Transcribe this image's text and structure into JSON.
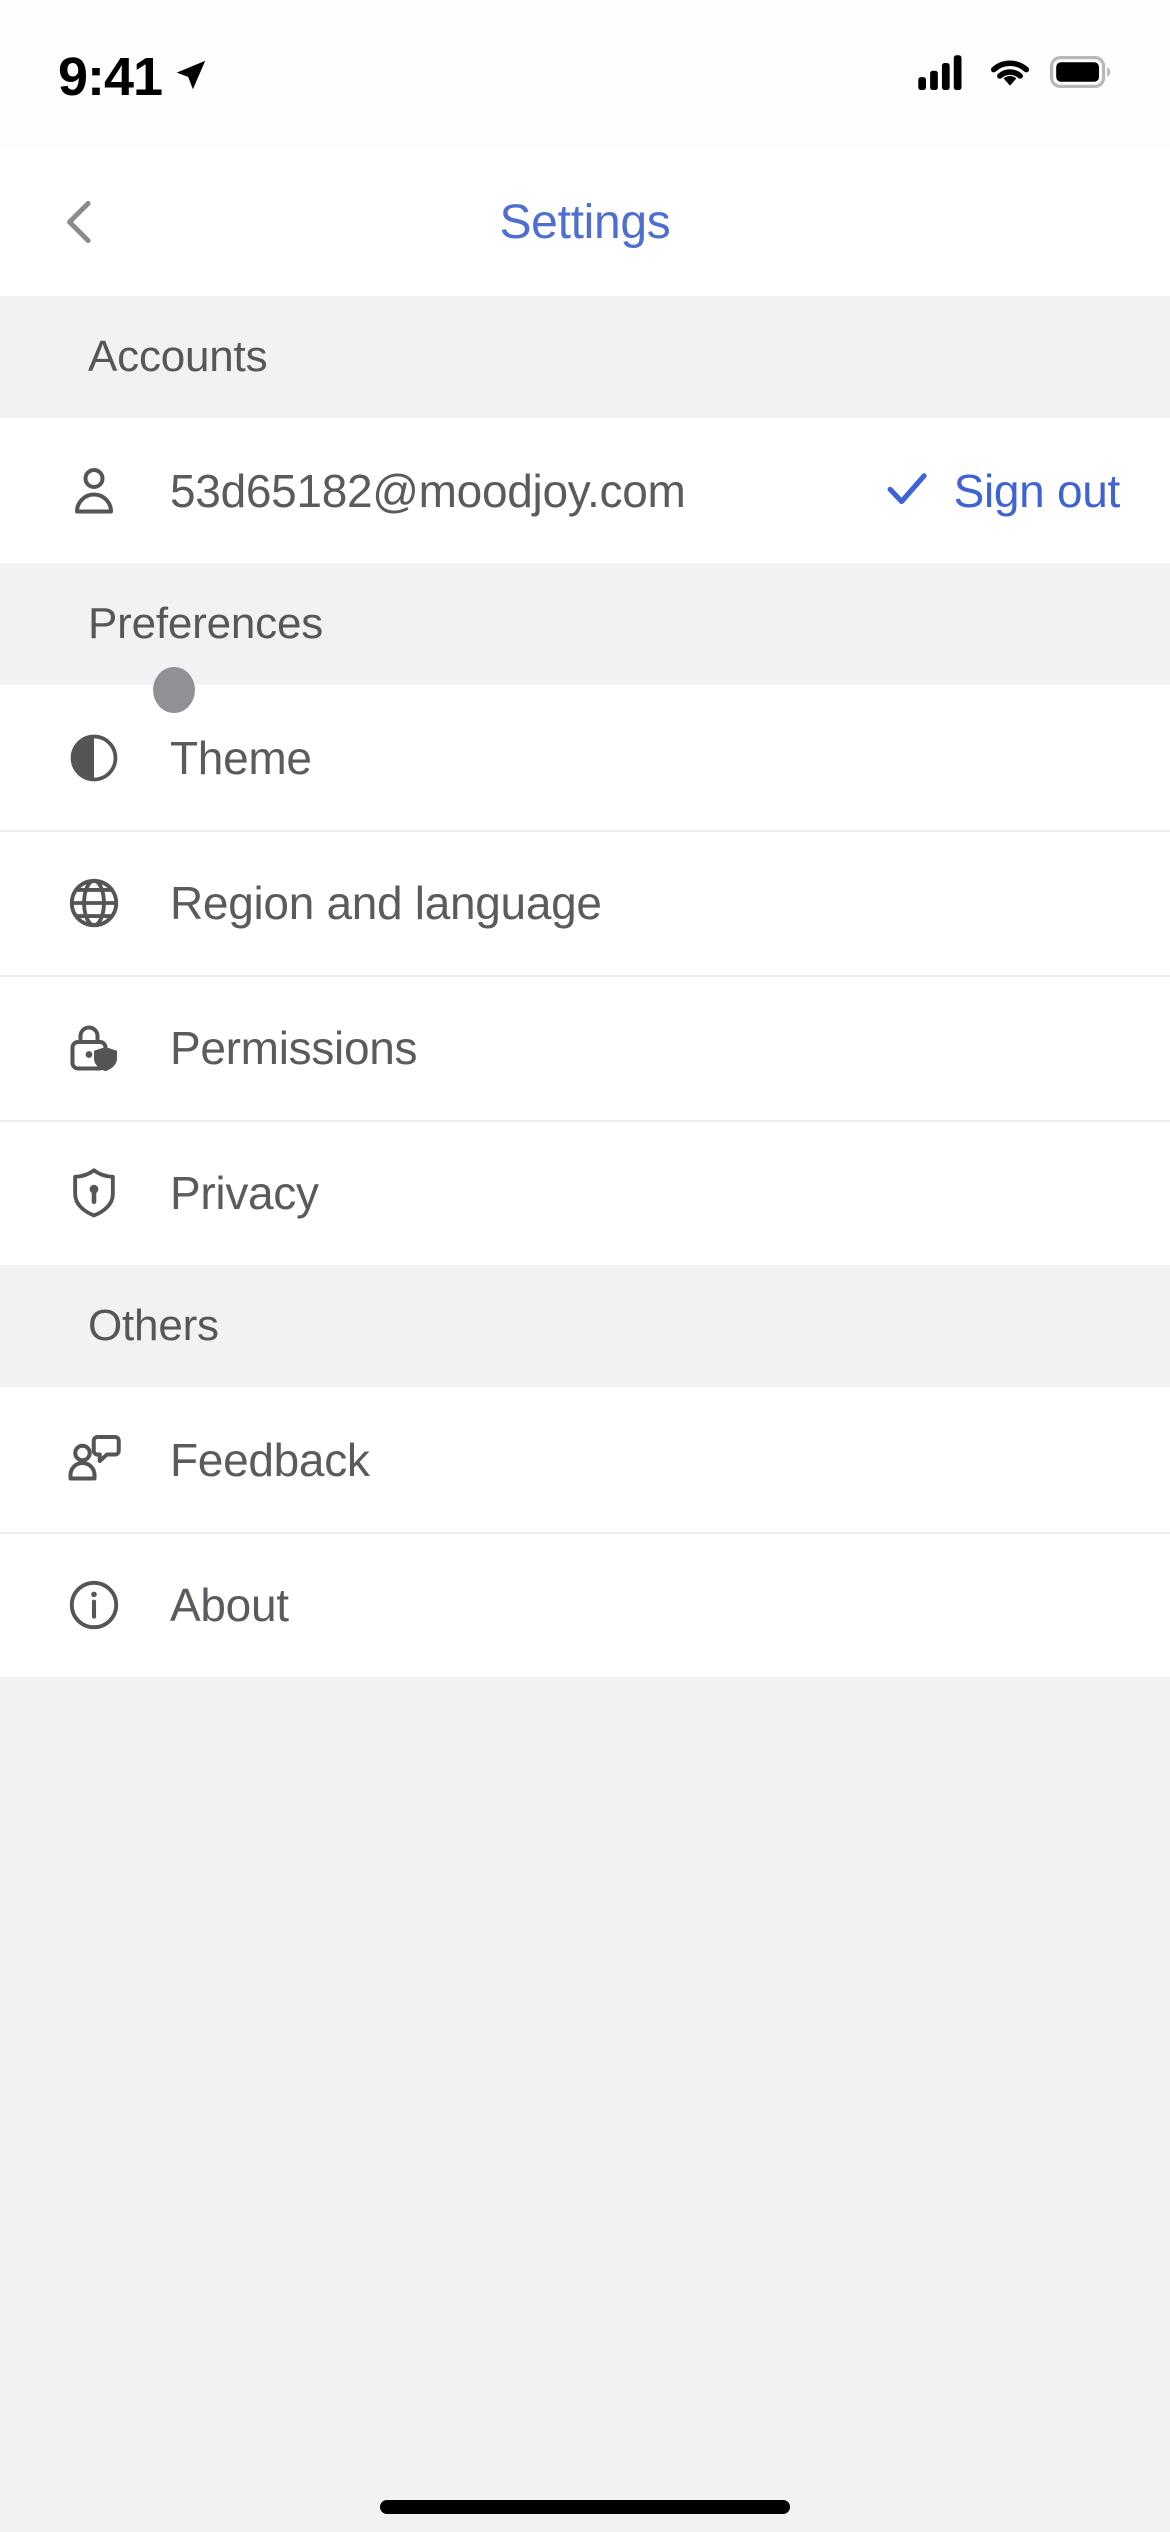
{
  "status_bar": {
    "time": "9:41",
    "location_icon": "location-arrow-icon",
    "cellular_icon": "cellular-signal-icon",
    "wifi_icon": "wifi-icon",
    "battery_icon": "battery-full-icon"
  },
  "nav": {
    "back_icon": "chevron-left-icon",
    "title": "Settings",
    "title_color": "#4f6fd0"
  },
  "sections": [
    {
      "header": "Accounts",
      "rows": [
        {
          "icon": "person-icon",
          "label": "53d65182@moodjoy.com",
          "trailing_icon": "checkmark-icon",
          "trailing_label": "Sign out",
          "trailing_color": "#3f63d4"
        }
      ]
    },
    {
      "header": "Preferences",
      "rows": [
        {
          "icon": "contrast-circle-icon",
          "label": "Theme",
          "pressed": true
        },
        {
          "icon": "globe-icon",
          "label": "Region and language"
        },
        {
          "icon": "lock-shield-icon",
          "label": "Permissions"
        },
        {
          "icon": "shield-keyhole-icon",
          "label": "Privacy"
        }
      ]
    },
    {
      "header": "Others",
      "rows": [
        {
          "icon": "person-message-icon",
          "label": "Feedback"
        },
        {
          "icon": "info-circle-icon",
          "label": "About"
        }
      ]
    }
  ],
  "home_indicator": {
    "name": "home-indicator-bar",
    "color": "#000000"
  },
  "colors": {
    "page_background": "#f2f1f4",
    "row_background": "#ffffff",
    "separator": "#ececee",
    "label_text": "#5b5a5e",
    "section_header_text": "#57565a",
    "accent_blue": "#3f63d4",
    "tap_indicator": "#909096",
    "icon_stroke": "#555558"
  }
}
